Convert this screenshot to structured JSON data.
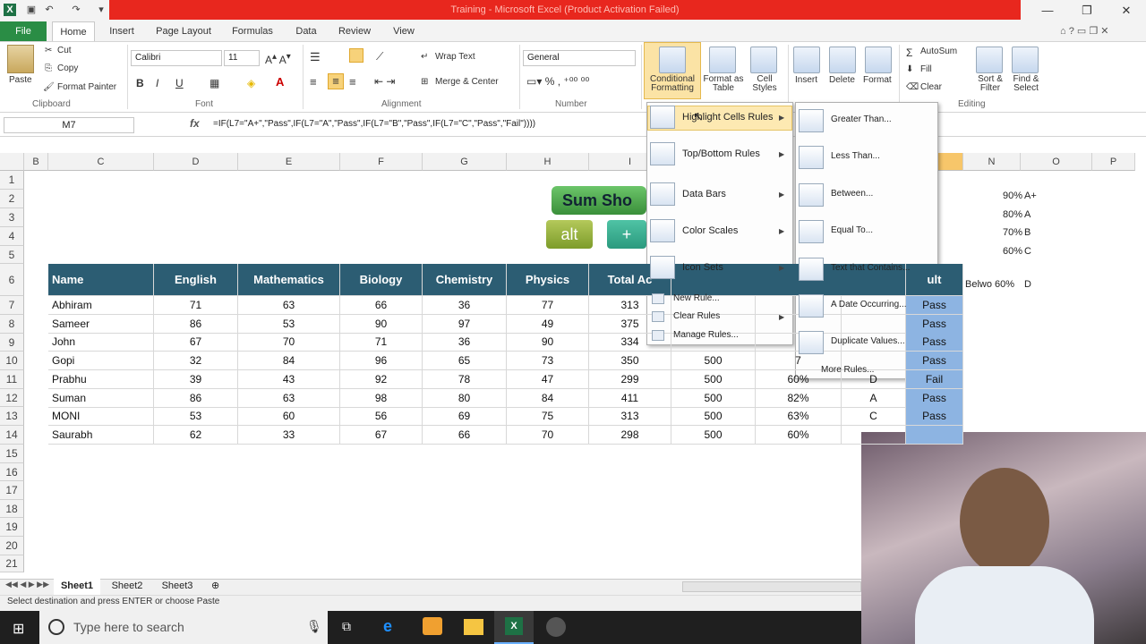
{
  "window": {
    "title": "Training - Microsoft Excel (Product Activation Failed)"
  },
  "tabs": [
    "File",
    "Home",
    "Insert",
    "Page Layout",
    "Formulas",
    "Data",
    "Review",
    "View"
  ],
  "ribbon": {
    "clipboard": {
      "paste": "Paste",
      "cut": "Cut",
      "copy": "Copy",
      "format_painter": "Format Painter",
      "label": "Clipboard"
    },
    "font": {
      "name": "Calibri",
      "size": "11",
      "label": "Font"
    },
    "alignment": {
      "wrap": "Wrap Text",
      "merge": "Merge & Center",
      "label": "Alignment"
    },
    "number": {
      "format": "General",
      "label": "Number"
    },
    "styles": {
      "cf": "Conditional Formatting",
      "fat": "Format as Table",
      "cs": "Cell Styles"
    },
    "cells": {
      "insert": "Insert",
      "delete": "Delete",
      "format": "Format"
    },
    "editing": {
      "autosum": "AutoSum",
      "fill": "Fill",
      "clear": "Clear",
      "sort": "Sort & Filter",
      "find": "Find & Select",
      "label": "Editing"
    }
  },
  "formula_bar": {
    "name_box": "M7",
    "fx": "fx",
    "formula": "=IF(L7=\"A+\",\"Pass\",IF(L7=\"A\",\"Pass\",IF(L7=\"B\",\"Pass\",IF(L7=\"C\",\"Pass\",\"Fail\"))))"
  },
  "columns": [
    "B",
    "C",
    "D",
    "E",
    "F",
    "G",
    "H",
    "I",
    "N",
    "O",
    "P"
  ],
  "rows": [
    "1",
    "2",
    "3",
    "4",
    "5",
    "6",
    "7",
    "8",
    "9",
    "10",
    "11",
    "12",
    "13",
    "14",
    "15",
    "16",
    "17",
    "18",
    "19",
    "20",
    "21"
  ],
  "shapes": {
    "sum": "Sum Sho",
    "alt": "alt",
    "plus": "+"
  },
  "grades": [
    [
      "90%",
      "A+"
    ],
    [
      "80%",
      "A"
    ],
    [
      "70%",
      "B"
    ],
    [
      "60%",
      "C"
    ],
    [
      "Belwo 60%",
      "D"
    ]
  ],
  "table": {
    "headers": [
      "Name",
      "English",
      "Mathematics",
      "Biology",
      "Chemistry",
      "Physics",
      "Total Ac",
      "ult"
    ],
    "rows": [
      [
        "Abhiram",
        "71",
        "63",
        "66",
        "36",
        "77",
        "313",
        "",
        "",
        "",
        "Pass"
      ],
      [
        "Sameer",
        "86",
        "53",
        "90",
        "97",
        "49",
        "375",
        "",
        "",
        "",
        "Pass"
      ],
      [
        "John",
        "67",
        "70",
        "71",
        "36",
        "90",
        "334",
        "",
        "",
        "",
        "Pass"
      ],
      [
        "Gopi",
        "32",
        "84",
        "96",
        "65",
        "73",
        "350",
        "500",
        "7",
        "",
        "Pass"
      ],
      [
        "Prabhu",
        "39",
        "43",
        "92",
        "78",
        "47",
        "299",
        "500",
        "60%",
        "D",
        "Fail"
      ],
      [
        "Suman",
        "86",
        "63",
        "98",
        "80",
        "84",
        "411",
        "500",
        "82%",
        "A",
        "Pass"
      ],
      [
        "MONI",
        "53",
        "60",
        "56",
        "69",
        "75",
        "313",
        "500",
        "63%",
        "C",
        "Pass"
      ],
      [
        "Saurabh",
        "62",
        "33",
        "67",
        "66",
        "70",
        "298",
        "500",
        "60%",
        "",
        ""
      ]
    ]
  },
  "cf_menu": {
    "items": [
      "Highlight Cells Rules",
      "Top/Bottom Rules",
      "Data Bars",
      "Color Scales",
      "Icon Sets"
    ],
    "small": [
      "New Rule...",
      "Clear Rules",
      "Manage Rules..."
    ]
  },
  "sub_menu": {
    "items": [
      "Greater Than...",
      "Less Than...",
      "Between...",
      "Equal To...",
      "Text that Contains...",
      "A Date Occurring...",
      "Duplicate Values..."
    ],
    "more": "More Rules..."
  },
  "sheets": [
    "Sheet1",
    "Sheet2",
    "Sheet3"
  ],
  "status": "Select destination and press ENTER or choose Paste",
  "taskbar": {
    "search": "Type here to search"
  }
}
